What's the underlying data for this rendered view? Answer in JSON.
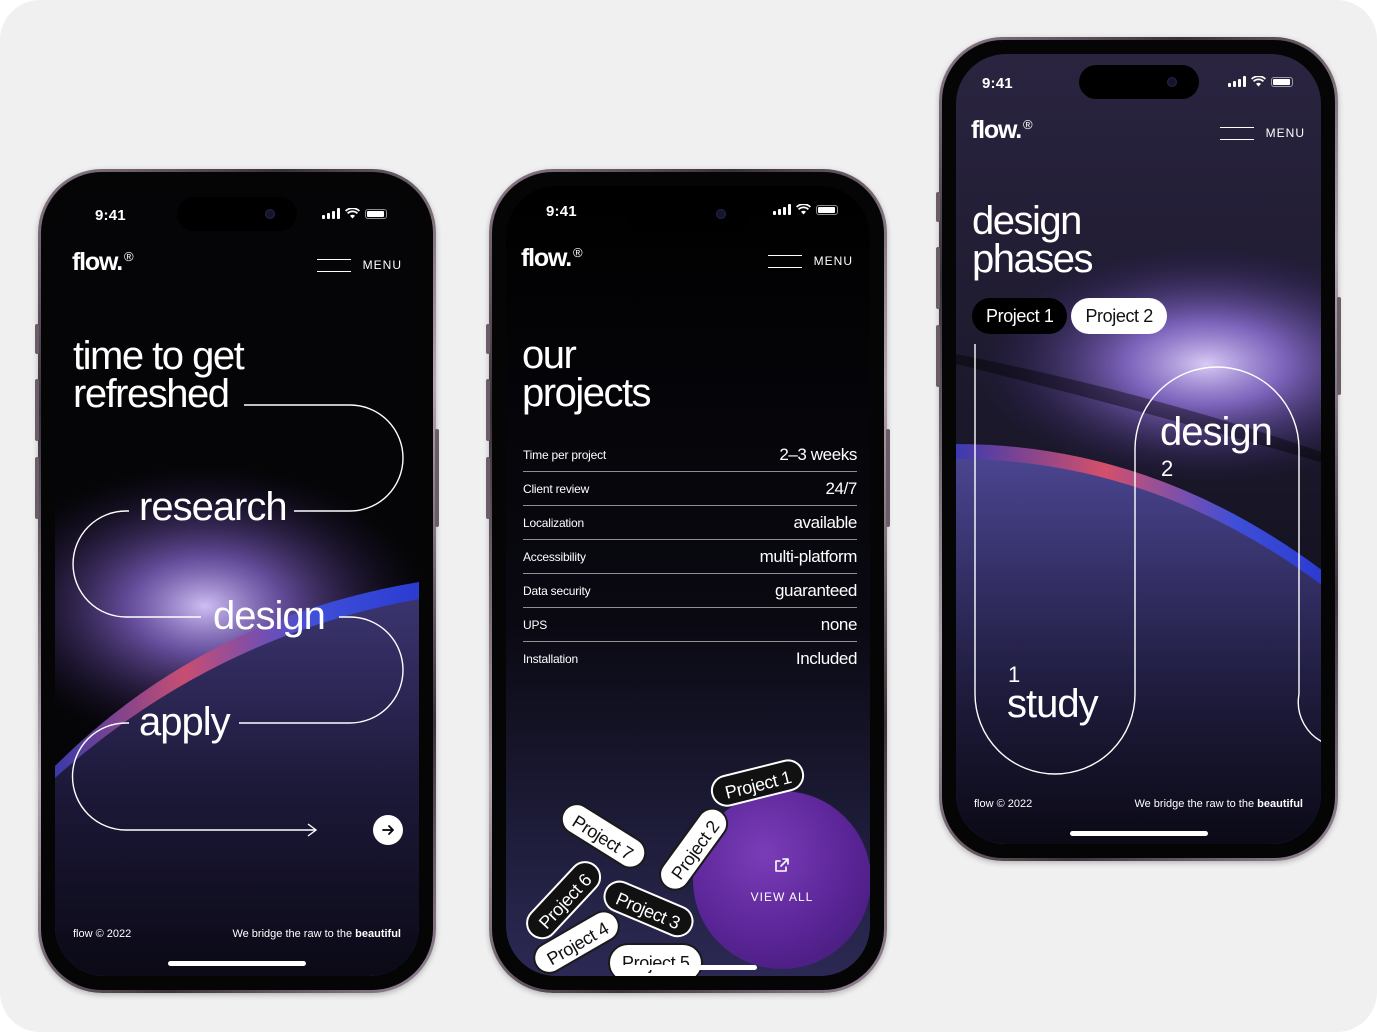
{
  "status_time": "9:41",
  "brand": {
    "name": "flow.",
    "mark": "®"
  },
  "menu_label": "MENU",
  "footer": {
    "copyright": "flow © 2022",
    "tagline_prefix": "We bridge the raw to the ",
    "tagline_bold": "beautiful"
  },
  "home": {
    "headline_line1": "time to get",
    "headline_line2": "refreshed",
    "steps": [
      "research",
      "design",
      "apply"
    ]
  },
  "projects": {
    "title_line1": "our",
    "title_line2": "projects",
    "rows": [
      {
        "label": "Time per project",
        "value": "2–3 weeks"
      },
      {
        "label": "Client review",
        "value": "24/7"
      },
      {
        "label": "Localization",
        "value": "available"
      },
      {
        "label": "Accessibility",
        "value": "multi-platform"
      },
      {
        "label": "Data security",
        "value": "guaranteed"
      },
      {
        "label": "UPS",
        "value": "none"
      },
      {
        "label": "Installation",
        "value": "Included"
      }
    ],
    "tags": [
      "Project 1",
      "Project 2",
      "Project 3",
      "Project 4",
      "Project 5",
      "Project 6",
      "Project 7"
    ],
    "view_all": "VIEW ALL"
  },
  "phases": {
    "title_line1": "design",
    "title_line2": "phases",
    "tabs": [
      "Project 1",
      "Project 2"
    ],
    "active_tab": "Project 1",
    "phase1_number": "1",
    "phase1_label": "study",
    "phase2_label": "design",
    "phase2_number": "2"
  },
  "colors": {
    "background": "#f0f0f0",
    "screen": "#050507",
    "accent_purple": "#5a2496",
    "glow_violet": "#9a7ae8",
    "glow_blue": "#3f4fd8",
    "glow_red": "#d4506a"
  }
}
